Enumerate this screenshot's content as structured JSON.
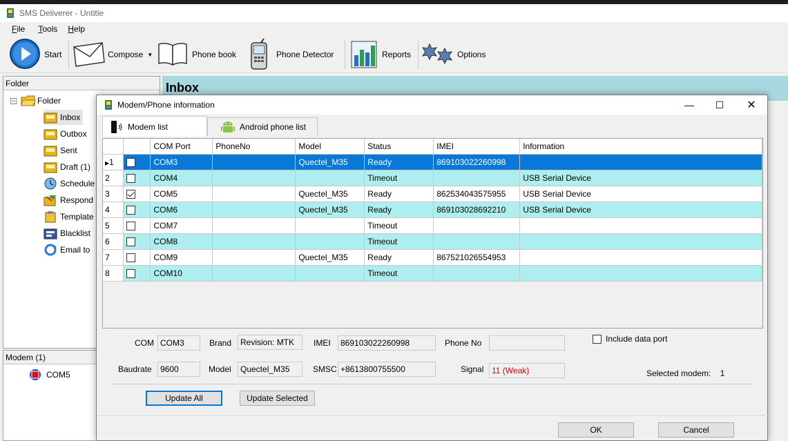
{
  "app": {
    "title": "SMS Deliverer - Untitle"
  },
  "menu": [
    {
      "label": "File",
      "accel": "F",
      "rest": "ile"
    },
    {
      "label": "Tools",
      "accel": "T",
      "rest": "ools"
    },
    {
      "label": "Help",
      "accel": "H",
      "rest": "elp"
    }
  ],
  "toolbar": {
    "start": "Start",
    "compose": "Compose",
    "phonebook": "Phone book",
    "detector": "Phone Detector",
    "reports": "Reports",
    "options": "Options"
  },
  "folder_pane": {
    "header": "Folder",
    "root": "Folder",
    "items": [
      "Inbox",
      "Outbox",
      "Sent",
      "Draft (1)",
      "Schedule",
      "Respond",
      "Template",
      "Blacklist",
      "Email to"
    ]
  },
  "modem_pane": {
    "header": "Modem (1)",
    "items": [
      "COM5"
    ]
  },
  "main": {
    "title": "Inbox"
  },
  "dialog": {
    "title": "Modem/Phone information",
    "tabs": [
      "Modem list",
      "Android phone list"
    ],
    "columns": [
      "COM Port",
      "PhoneNo",
      "Model",
      "Status",
      "IMEI",
      "Information"
    ],
    "rows": [
      {
        "n": "1",
        "checked": false,
        "com": "COM3",
        "phone": "",
        "model": "Quectel_M35",
        "status": "Ready",
        "imei": "869103022260998",
        "info": "",
        "selected": true
      },
      {
        "n": "2",
        "checked": false,
        "com": "COM4",
        "phone": "",
        "model": "",
        "status": "Timeout",
        "imei": "",
        "info": "USB Serial Device"
      },
      {
        "n": "3",
        "checked": true,
        "com": "COM5",
        "phone": "",
        "model": "Quectel_M35",
        "status": "Ready",
        "imei": "862534043575955",
        "info": "USB Serial Device"
      },
      {
        "n": "4",
        "checked": false,
        "com": "COM6",
        "phone": "",
        "model": "Quectel_M35",
        "status": "Ready",
        "imei": "869103028692210",
        "info": "USB Serial Device"
      },
      {
        "n": "5",
        "checked": false,
        "com": "COM7",
        "phone": "",
        "model": "",
        "status": "Timeout",
        "imei": "",
        "info": ""
      },
      {
        "n": "6",
        "checked": false,
        "com": "COM8",
        "phone": "",
        "model": "",
        "status": "Timeout",
        "imei": "",
        "info": ""
      },
      {
        "n": "7",
        "checked": false,
        "com": "COM9",
        "phone": "",
        "model": "Quectel_M35",
        "status": "Ready",
        "imei": "867521026554953",
        "info": ""
      },
      {
        "n": "8",
        "checked": false,
        "com": "COM10",
        "phone": "",
        "model": "",
        "status": "Timeout",
        "imei": "",
        "info": ""
      }
    ],
    "details": {
      "com_label": "COM",
      "com": "COM3",
      "brand_label": "Brand",
      "brand": "Revision: MTK",
      "imei_label": "IMEI",
      "imei": "869103022260998",
      "phone_label": "Phone No",
      "phone": "",
      "baud_label": "Baudrate",
      "baud": "9600",
      "model_label": "Model",
      "model": "Quectel_M35",
      "smsc_label": "SMSC",
      "smsc": "+8613800755500",
      "signal_label": "Signal",
      "signal": "11 (Weak)",
      "include_data_port": "Include data port",
      "selected_label": "Selected modem:",
      "selected": "1"
    },
    "buttons": {
      "update_all": "Update All",
      "update_selected": "Update Selected",
      "ok": "OK",
      "cancel": "Cancel"
    },
    "colors": {
      "selection": "#0a78d7",
      "alt_row": "#afeeee",
      "signal": "#e00000"
    }
  }
}
